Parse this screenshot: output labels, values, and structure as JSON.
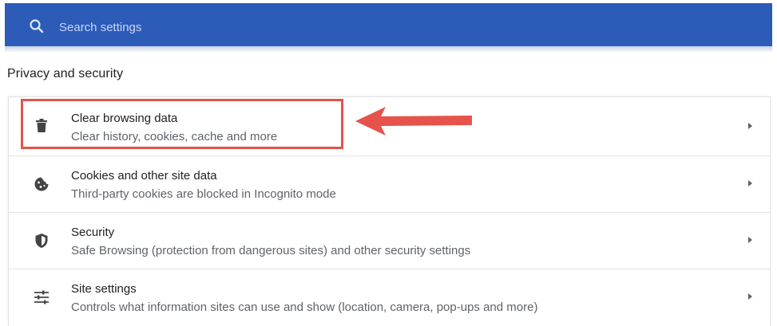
{
  "search": {
    "placeholder": "Search settings",
    "value": ""
  },
  "section": {
    "title": "Privacy and security"
  },
  "rows": [
    {
      "title": "Clear browsing data",
      "subtitle": "Clear history, cookies, cache and more",
      "icon": "trash-icon"
    },
    {
      "title": "Cookies and other site data",
      "subtitle": "Third-party cookies are blocked in Incognito mode",
      "icon": "cookie-icon"
    },
    {
      "title": "Security",
      "subtitle": "Safe Browsing (protection from dangerous sites) and other security settings",
      "icon": "shield-icon"
    },
    {
      "title": "Site settings",
      "subtitle": "Controls what information sites can use and show (location, camera, pop-ups and more)",
      "icon": "sliders-icon"
    }
  ],
  "colors": {
    "header_bg": "#2c5bb8",
    "annotation": "#e5534b",
    "text_primary": "#202124",
    "text_secondary": "#5f6368"
  }
}
